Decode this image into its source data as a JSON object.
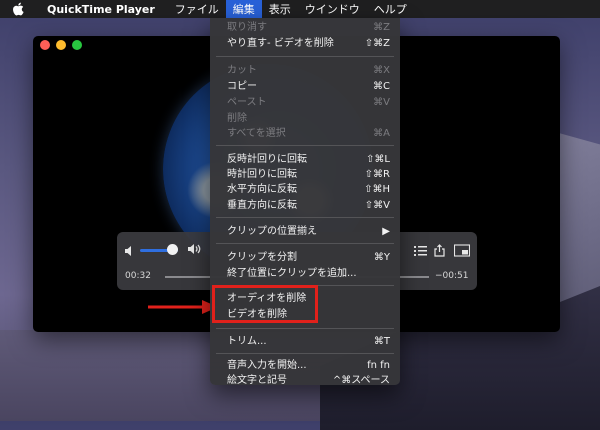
{
  "menubar": {
    "app_name": "QuickTime Player",
    "items": [
      "ファイル",
      "編集",
      "表示",
      "ウインドウ",
      "ヘルプ"
    ],
    "active_index": 1
  },
  "player": {
    "time_elapsed": "00:32",
    "time_remaining": "−00:51",
    "volume_level": 0.85
  },
  "edit_menu": {
    "items": [
      {
        "label": "取り消す",
        "shortcut": "⌘Z",
        "enabled": false
      },
      {
        "label": "やり直す- ビデオを削除",
        "shortcut": "⇧⌘Z",
        "enabled": true
      },
      {
        "label": "カット",
        "shortcut": "⌘X",
        "enabled": false
      },
      {
        "label": "コピー",
        "shortcut": "⌘C",
        "enabled": true
      },
      {
        "label": "ペースト",
        "shortcut": "⌘V",
        "enabled": false
      },
      {
        "label": "削除",
        "shortcut": "",
        "enabled": false
      },
      {
        "label": "すべてを選択",
        "shortcut": "⌘A",
        "enabled": false
      },
      {
        "label": "反時計回りに回転",
        "shortcut": "⇧⌘L",
        "enabled": true
      },
      {
        "label": "時計回りに回転",
        "shortcut": "⇧⌘R",
        "enabled": true
      },
      {
        "label": "水平方向に反転",
        "shortcut": "⇧⌘H",
        "enabled": true
      },
      {
        "label": "垂直方向に反転",
        "shortcut": "⇧⌘V",
        "enabled": true
      },
      {
        "label": "クリップの位置揃え",
        "shortcut": "▶",
        "enabled": true
      },
      {
        "label": "クリップを分割",
        "shortcut": "⌘Y",
        "enabled": true
      },
      {
        "label": "終了位置にクリップを追加...",
        "shortcut": "",
        "enabled": true
      },
      {
        "label": "オーディオを削除",
        "shortcut": "",
        "enabled": true
      },
      {
        "label": "ビデオを削除",
        "shortcut": "",
        "enabled": true
      },
      {
        "label": "トリム...",
        "shortcut": "⌘T",
        "enabled": true
      },
      {
        "label": "音声入力を開始...",
        "shortcut": "fn fn",
        "enabled": true
      },
      {
        "label": "絵文字と記号",
        "shortcut": "^⌘スペース",
        "enabled": true
      }
    ]
  },
  "colors": {
    "menu_highlight": "#2861d8",
    "annotation_red": "#e1211b"
  },
  "icons": [
    "apple-icon",
    "volume-low-icon",
    "volume-high-icon",
    "chapters-icon",
    "share-icon",
    "pip-icon"
  ]
}
